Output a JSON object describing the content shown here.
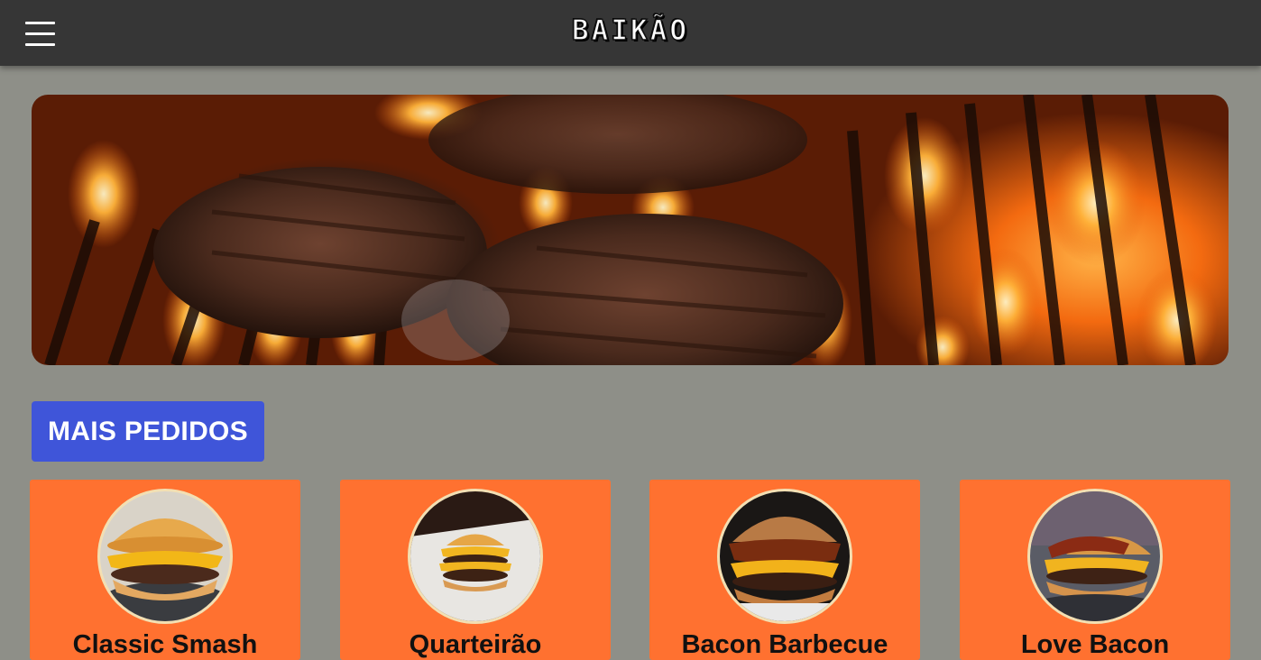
{
  "header": {
    "logo_text": "BAIKÃO",
    "menu_icon": "hamburger-menu-icon",
    "background_color": "#363636"
  },
  "hero": {
    "image": "burgers-on-grill-photo"
  },
  "section": {
    "title": "MAIS PEDIDOS",
    "color": "#3f55d9"
  },
  "products": [
    {
      "name": "Classic Smash",
      "image": "classic-smash-burger-photo"
    },
    {
      "name": "Quarteirão",
      "image": "quarteirao-burger-photo"
    },
    {
      "name": "Bacon Barbecue",
      "image": "bacon-barbecue-burger-photo"
    },
    {
      "name": "Love Bacon",
      "image": "love-bacon-burger-photo"
    }
  ],
  "colors": {
    "page_background": "#8e8f88",
    "card_background": "#ff7130",
    "photo_border": "#f3dfb2"
  }
}
